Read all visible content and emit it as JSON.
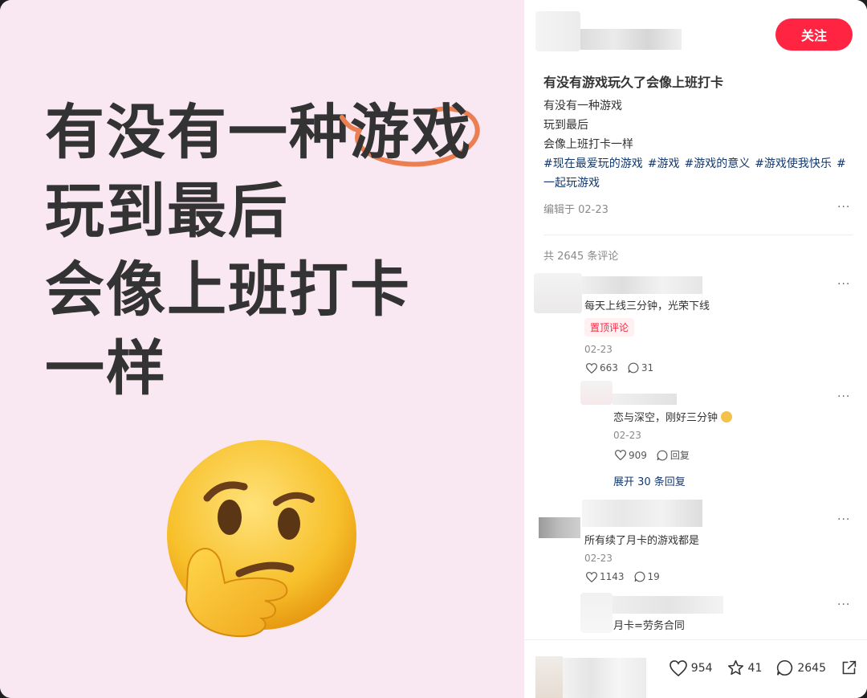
{
  "image": {
    "lines": [
      "有没有一种",
      "游戏",
      "玩到最后",
      "会像上班打卡",
      "一样"
    ],
    "emoji": "thinking-face-emoji"
  },
  "note": {
    "follow_label": "关注",
    "title": "有没有游戏玩久了会像上班打卡",
    "body": [
      "有没有一种游戏",
      "玩到最后",
      "会像上班打卡一样"
    ],
    "tags": [
      "#现在最爱玩的游戏",
      "#游戏",
      "#游戏的意义",
      "#游戏使我快乐",
      "#一起玩游戏"
    ],
    "edit_date": "编辑于 02-23",
    "comment_total": "共 2645 条评论"
  },
  "comments": [
    {
      "text": "每天上线三分钟，光荣下线",
      "badge": "置顶评论",
      "date": "02-23",
      "likes": "663",
      "replies": "31"
    },
    {
      "text": "恋与深空，刚好三分钟",
      "date": "02-23",
      "likes": "909",
      "reply_label": "回复",
      "expand": "展开 30 条回复"
    },
    {
      "text": "所有续了月卡的游戏都是",
      "date": "02-23",
      "likes": "1143",
      "replies": "19"
    },
    {
      "text": "月卡=劳务合同"
    }
  ],
  "bottom": {
    "likes": "954",
    "stars": "41",
    "comments": "2645"
  },
  "colors": {
    "accent": "#ff2442",
    "tag": "#13386c",
    "image_bg": "#f9e8f1"
  }
}
